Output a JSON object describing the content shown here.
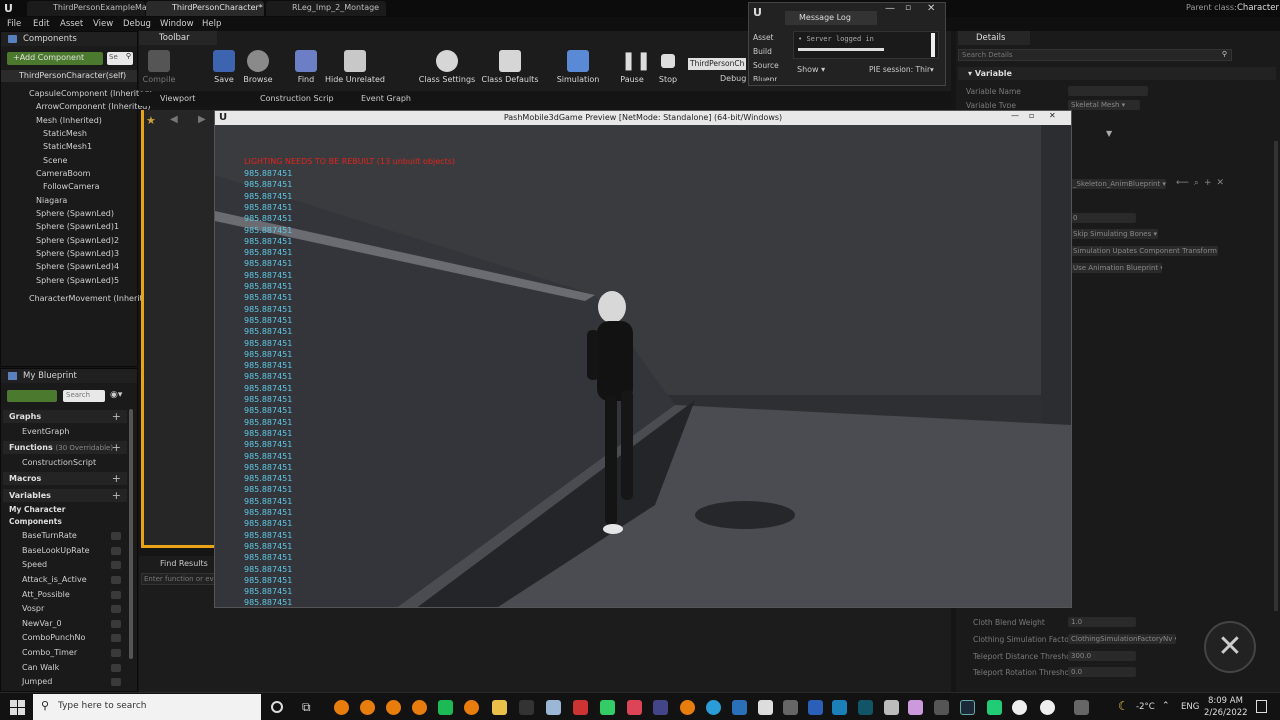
{
  "doc_tabs": [
    "ThirdPersonExampleMap*",
    "ThirdPersonCharacter*",
    "RLeg_Imp_2_Montage"
  ],
  "parent_class": {
    "label": "Parent class:",
    "value": "Character"
  },
  "menu": [
    "File",
    "Edit",
    "Asset",
    "View",
    "Debug",
    "Window",
    "Help"
  ],
  "components": {
    "header": "Components",
    "add_button": "+Add Component",
    "search_placeholder": "Se",
    "self": "ThirdPersonCharacter(self)",
    "items": [
      "CapsuleComponent (Inherited)",
      "ArrowComponent (Inherited)",
      "Mesh (Inherited)",
      "StaticMesh",
      "StaticMesh1",
      "Scene",
      "CameraBoom",
      "FollowCamera",
      "Niagara",
      "Sphere (SpawnLed)",
      "Sphere (SpawnLed)1",
      "Sphere (SpawnLed)2",
      "Sphere (SpawnLed)3",
      "Sphere (SpawnLed)4",
      "Sphere (SpawnLed)5",
      "CharacterMovement (Inherite"
    ]
  },
  "toolbar": {
    "header": "Toolbar",
    "compile": "Compile",
    "save": "Save",
    "browse": "Browse",
    "find": "Find",
    "hide_unrelated": "Hide Unrelated",
    "class_settings": "Class Settings",
    "class_defaults": "Class Defaults",
    "simulation": "Simulation",
    "pause": "Pause",
    "stop": "Stop",
    "debug_object": "ThirdPersonCh",
    "debug_label": "Debug"
  },
  "editor_tabs": [
    "Viewport",
    "Construction Scrip",
    "Event Graph"
  ],
  "my_blueprint": {
    "header": "My Blueprint",
    "search_placeholder": "Search",
    "graphs": "Graphs",
    "event_graph": "EventGraph",
    "functions": "Functions",
    "functions_note": "(30 Overridable)",
    "construction_script": "ConstructionScript",
    "macros": "Macros",
    "variables": "Variables",
    "my_character": "My Character",
    "components_label": "Components",
    "vars": [
      "BaseTurnRate",
      "BaseLookUpRate",
      "Speed",
      "Attack_is_Active",
      "Att_Possible",
      "Vospr",
      "NewVar_0",
      "ComboPunchNo",
      "Combo_Timer",
      "Can Walk",
      "Jumped"
    ]
  },
  "find_results": {
    "header": "Find Results",
    "placeholder": "Enter function or ev"
  },
  "message_log": {
    "tab": "Message Log",
    "side_items": [
      "Asset",
      "Build",
      "Source",
      "Bluepr"
    ],
    "entry": "Server logged in",
    "show": "Show",
    "pie_session": "PIE session: Thir"
  },
  "game_window": {
    "title": "PashMobile3dGame Preview [NetMode: Standalone] (64-bit/Windows)",
    "warning": "LIGHTING NEEDS TO BE REBUILT (13 unbuilt objects)",
    "stat_value": "985.887451",
    "stat_count": 39
  },
  "details": {
    "tab": "Details",
    "search_placeholder": "Search Details",
    "variable_section": "Variable",
    "variable_name_label": "Variable Name",
    "variable_type_label": "Variable Type",
    "variable_type_value": "Skeletal Mesh",
    "anim_bp": "_Skeleton_AnimBlueprint",
    "skip_bones": "Skip Simulating Bones",
    "sim_updates": "Simulation Upates Component Transform",
    "use_anim_bp": "Use Animation Blueprint",
    "zero": "0",
    "cloth_blend_label": "Cloth Blend Weight",
    "cloth_blend_value": "1.0",
    "cloth_factory_label": "Clothing Simulation Factory",
    "cloth_factory_value": "ClothingSimulationFactoryNv",
    "teleport_dist_label": "Teleport Distance Threshol",
    "teleport_dist_value": "300.0",
    "teleport_rot_label": "Teleport Rotation Threshol",
    "teleport_rot_value": "0.0"
  },
  "taskbar": {
    "search_placeholder": "Type here to search",
    "temperature": "-2°C",
    "language": "ENG",
    "time": "8:09 AM",
    "date": "2/26/2022"
  },
  "colors": {
    "accent_orange": "#e8a317",
    "stat_cyan": "#5ec8e6",
    "warning_red": "#e0241c"
  }
}
